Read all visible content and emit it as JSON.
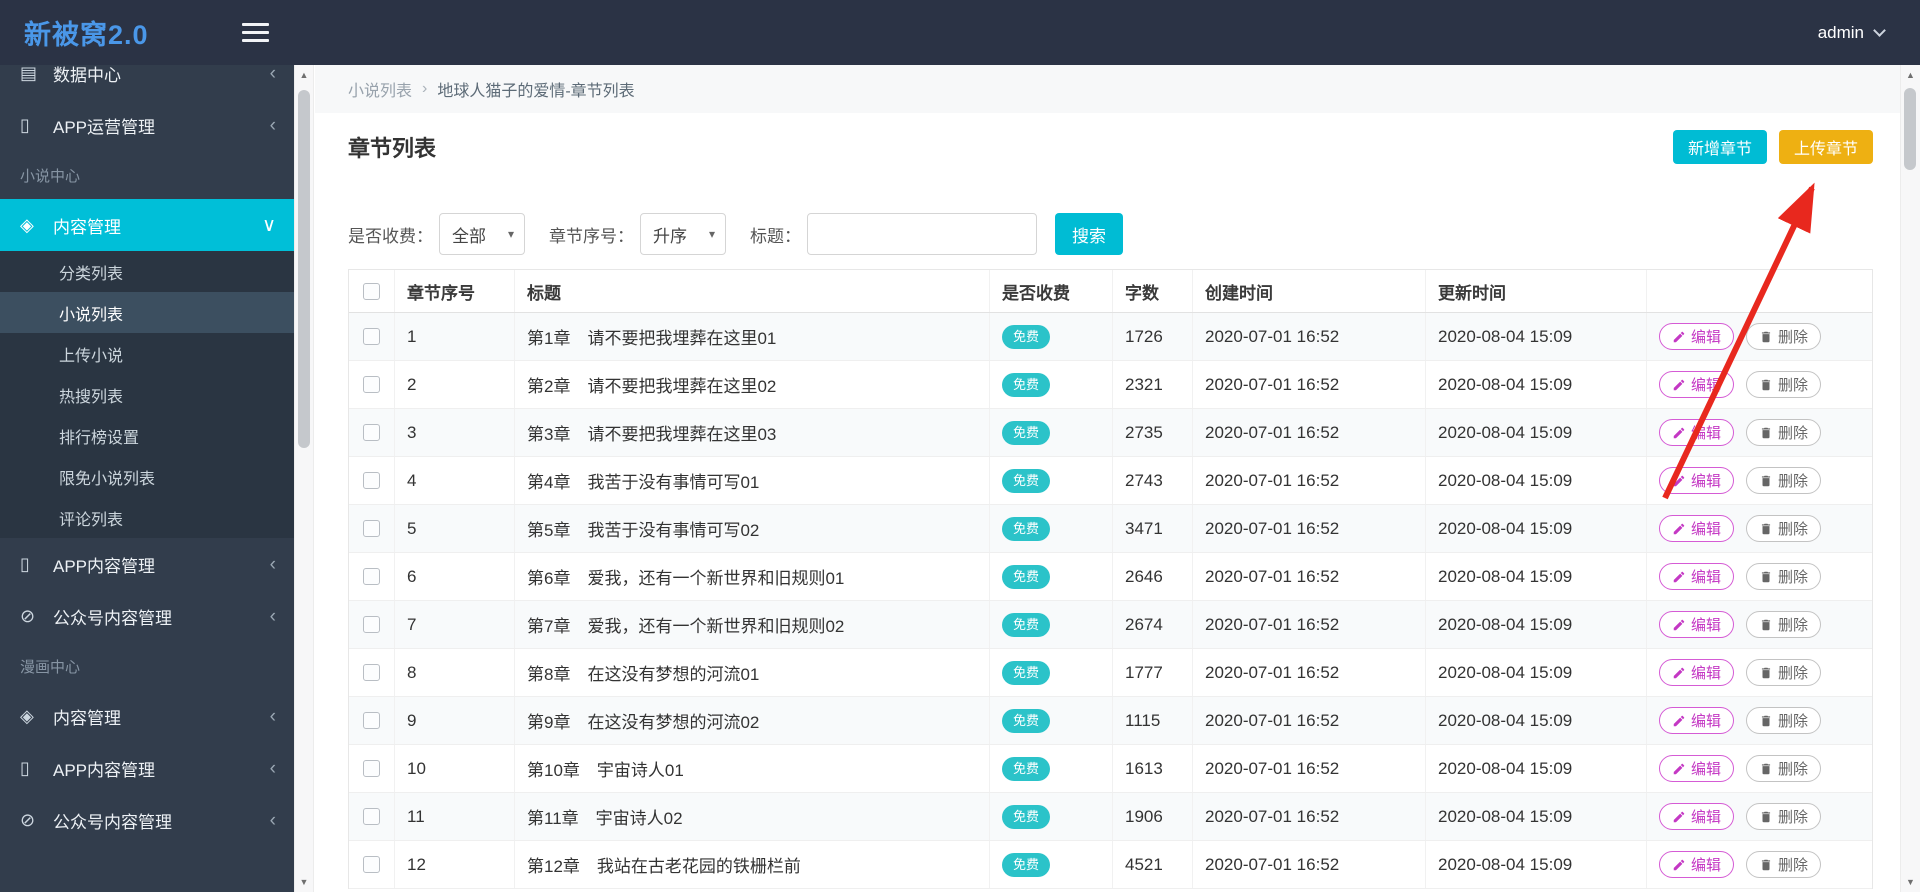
{
  "header": {
    "logo": "新被窝2.0",
    "user": "admin"
  },
  "sidebar": {
    "items": [
      {
        "label": "数据中心",
        "icon": "▤",
        "icon_name": "data-center-icon",
        "chevron": "‹",
        "cls": ""
      },
      {
        "label": "APP运营管理",
        "icon": "▯",
        "icon_name": "app-operations-icon",
        "chevron": "‹",
        "cls": ""
      },
      {
        "label": "小说中心",
        "cls": "section"
      },
      {
        "label": "内容管理",
        "icon": "◈",
        "icon_name": "content-manage-icon",
        "chevron": "∨",
        "cls": "active"
      },
      {
        "label": "分类列表",
        "cls": "sub"
      },
      {
        "label": "小说列表",
        "cls": "sub current"
      },
      {
        "label": "上传小说",
        "cls": "sub"
      },
      {
        "label": "热搜列表",
        "cls": "sub"
      },
      {
        "label": "排行榜设置",
        "cls": "sub"
      },
      {
        "label": "限免小说列表",
        "cls": "sub"
      },
      {
        "label": "评论列表",
        "cls": "sub"
      },
      {
        "label": "APP内容管理",
        "icon": "▯",
        "icon_name": "app-content-icon",
        "chevron": "‹",
        "cls": ""
      },
      {
        "label": "公众号内容管理",
        "icon": "⊘",
        "icon_name": "wechat-content-icon",
        "chevron": "‹",
        "cls": ""
      },
      {
        "label": "漫画中心",
        "cls": "section"
      },
      {
        "label": "内容管理",
        "icon": "◈",
        "icon_name": "content-manage-icon",
        "chevron": "‹",
        "cls": ""
      },
      {
        "label": "APP内容管理",
        "icon": "▯",
        "icon_name": "app-content-icon",
        "chevron": "‹",
        "cls": ""
      },
      {
        "label": "公众号内容管理",
        "icon": "⊘",
        "icon_name": "wechat-content-icon",
        "chevron": "‹",
        "cls": ""
      }
    ]
  },
  "breadcrumb": {
    "parent": "小说列表",
    "separator": "›",
    "current": "地球人猫子的爱情-章节列表"
  },
  "page": {
    "title": "章节列表",
    "add_button": "新增章节",
    "upload_button": "上传章节"
  },
  "filters": {
    "fee_label": "是否收费：",
    "fee_value": "全部",
    "order_label": "章节序号：",
    "order_value": "升序",
    "title_label": "标题：",
    "title_value": "",
    "search_button": "搜索"
  },
  "table": {
    "columns": [
      "章节序号",
      "标题",
      "是否收费",
      "字数",
      "创建时间",
      "更新时间"
    ],
    "edit_label": "编辑",
    "delete_label": "删除",
    "rows": [
      {
        "seq": "1",
        "title": "第1章　请不要把我埋葬在这里01",
        "fee": "免费",
        "words": "1726",
        "created": "2020-07-01 16:52",
        "updated": "2020-08-04 15:09"
      },
      {
        "seq": "2",
        "title": "第2章　请不要把我埋葬在这里02",
        "fee": "免费",
        "words": "2321",
        "created": "2020-07-01 16:52",
        "updated": "2020-08-04 15:09"
      },
      {
        "seq": "3",
        "title": "第3章　请不要把我埋葬在这里03",
        "fee": "免费",
        "words": "2735",
        "created": "2020-07-01 16:52",
        "updated": "2020-08-04 15:09"
      },
      {
        "seq": "4",
        "title": "第4章　我苦于没有事情可写01",
        "fee": "免费",
        "words": "2743",
        "created": "2020-07-01 16:52",
        "updated": "2020-08-04 15:09"
      },
      {
        "seq": "5",
        "title": "第5章　我苦于没有事情可写02",
        "fee": "免费",
        "words": "3471",
        "created": "2020-07-01 16:52",
        "updated": "2020-08-04 15:09"
      },
      {
        "seq": "6",
        "title": "第6章　爱我，还有一个新世界和旧规则01",
        "fee": "免费",
        "words": "2646",
        "created": "2020-07-01 16:52",
        "updated": "2020-08-04 15:09"
      },
      {
        "seq": "7",
        "title": "第7章　爱我，还有一个新世界和旧规则02",
        "fee": "免费",
        "words": "2674",
        "created": "2020-07-01 16:52",
        "updated": "2020-08-04 15:09"
      },
      {
        "seq": "8",
        "title": "第8章　在这没有梦想的河流01",
        "fee": "免费",
        "words": "1777",
        "created": "2020-07-01 16:52",
        "updated": "2020-08-04 15:09"
      },
      {
        "seq": "9",
        "title": "第9章　在这没有梦想的河流02",
        "fee": "免费",
        "words": "1115",
        "created": "2020-07-01 16:52",
        "updated": "2020-08-04 15:09"
      },
      {
        "seq": "10",
        "title": "第10章　宇宙诗人01",
        "fee": "免费",
        "words": "1613",
        "created": "2020-07-01 16:52",
        "updated": "2020-08-04 15:09"
      },
      {
        "seq": "11",
        "title": "第11章　宇宙诗人02",
        "fee": "免费",
        "words": "1906",
        "created": "2020-07-01 16:52",
        "updated": "2020-08-04 15:09"
      },
      {
        "seq": "12",
        "title": "第12章　我站在古老花园的铁栅栏前",
        "fee": "免费",
        "words": "4521",
        "created": "2020-07-01 16:52",
        "updated": "2020-08-04 15:09"
      }
    ]
  },
  "colors": {
    "accent_teal": "#00bcd4",
    "accent_gold": "#eeb012",
    "badge_teal": "#2bc3c9",
    "edit_magenta": "#c438c4",
    "delete_gray": "#666666",
    "sidebar_active": "#00bfd8",
    "arrow_red": "#e8281e"
  }
}
